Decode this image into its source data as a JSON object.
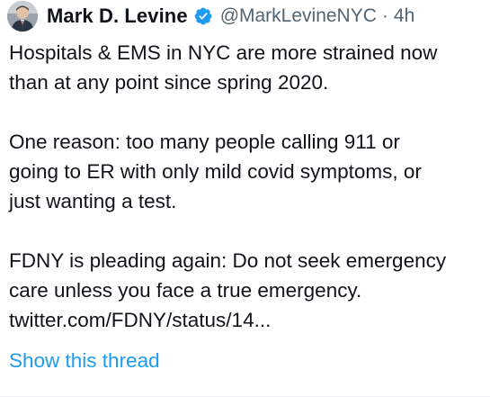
{
  "author": {
    "name": "Mark D. Levine",
    "handle": "@MarkLevineNYC",
    "separator": "·",
    "time": "4h",
    "verified": true,
    "verified_color": "#1d9bf0"
  },
  "tweet": {
    "paragraphs": [
      {
        "lines": [
          "Hospitals & EMS in NYC are more strained now",
          "than at any point since spring 2020."
        ]
      },
      {
        "lines": [
          "One reason: too many people calling 911 or",
          "going to ER with only mild covid symptoms, or",
          "just wanting a test."
        ]
      },
      {
        "lines": [
          "FDNY is pleading again: Do not seek emergency",
          "care unless you face a true emergency.",
          "twitter.com/FDNY/status/14..."
        ]
      }
    ]
  },
  "thread_link": {
    "label": "Show this thread",
    "color": "#1d9bf0"
  },
  "icons": {
    "avatar": "avatar-photo",
    "verified": "verified-badge-icon"
  }
}
